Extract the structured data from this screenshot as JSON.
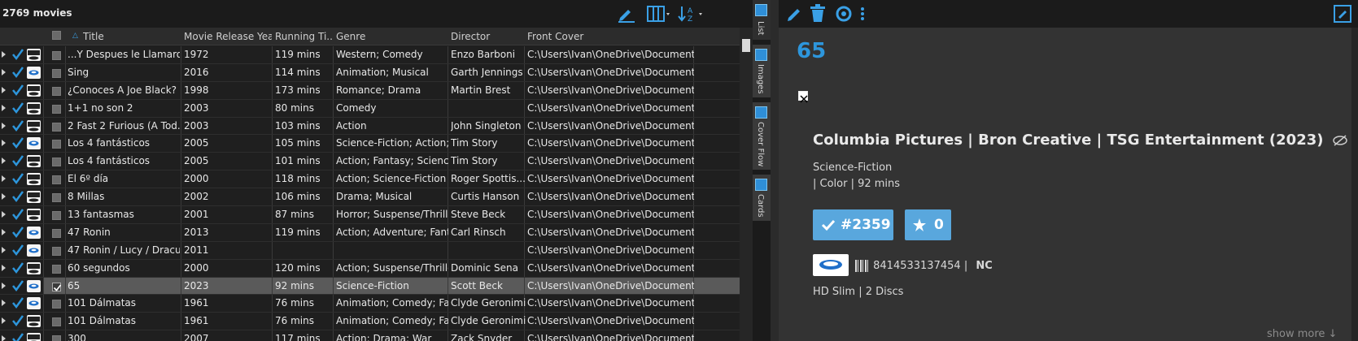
{
  "toolbar": {
    "movie_count": "2769 movies"
  },
  "columns": [
    "Title",
    "Movie Release Year",
    "Running Ti...",
    "Genre",
    "Director",
    "Front Cover"
  ],
  "rows": [
    {
      "title": "...Y Despues le Llamaro...",
      "year": "1972",
      "runtime": "119 mins",
      "genre": "Western; Comedy",
      "director": "Enzo Barboni",
      "cover": "C:\\Users\\Ivan\\OneDrive\\Document...",
      "media": "DVD",
      "checked": false,
      "selected": false
    },
    {
      "title": "Sing",
      "year": "2016",
      "runtime": "114 mins",
      "genre": "Animation; Musical",
      "director": "Garth Jennings",
      "cover": "C:\\Users\\Ivan\\OneDrive\\Document...",
      "media": "Blu-ray",
      "checked": false,
      "selected": false
    },
    {
      "title": "¿Conoces A Joe Black?",
      "year": "1998",
      "runtime": "173 mins",
      "genre": "Romance; Drama",
      "director": "Martin Brest",
      "cover": "C:\\Users\\Ivan\\OneDrive\\Document...",
      "media": "DVD",
      "checked": false,
      "selected": false
    },
    {
      "title": "1+1 no son 2",
      "year": "2003",
      "runtime": "80 mins",
      "genre": "Comedy",
      "director": "",
      "cover": "C:\\Users\\Ivan\\OneDrive\\Document...",
      "media": "DVD",
      "checked": false,
      "selected": false
    },
    {
      "title": "2 Fast 2 Furious (A Tod...",
      "year": "2003",
      "runtime": "103 mins",
      "genre": "Action",
      "director": "John Singleton",
      "cover": "C:\\Users\\Ivan\\OneDrive\\Document...",
      "media": "DVD",
      "checked": false,
      "selected": false
    },
    {
      "title": "Los 4 fantásticos",
      "year": "2005",
      "runtime": "105 mins",
      "genre": "Science-Fiction; Action; ...",
      "director": "Tim Story",
      "cover": "C:\\Users\\Ivan\\OneDrive\\Document...",
      "media": "Blu-ray",
      "checked": false,
      "selected": false
    },
    {
      "title": "Los 4 fantásticos",
      "year": "2005",
      "runtime": "101 mins",
      "genre": "Action; Fantasy; Science...",
      "director": "Tim Story",
      "cover": "C:\\Users\\Ivan\\OneDrive\\Document...",
      "media": "DVD",
      "checked": false,
      "selected": false
    },
    {
      "title": "El 6º día",
      "year": "2000",
      "runtime": "118 mins",
      "genre": "Action; Science-Fiction",
      "director": "Roger Spottis...",
      "cover": "C:\\Users\\Ivan\\OneDrive\\Document...",
      "media": "DVD",
      "checked": false,
      "selected": false
    },
    {
      "title": "8 Millas",
      "year": "2002",
      "runtime": "106 mins",
      "genre": "Drama; Musical",
      "director": "Curtis Hanson",
      "cover": "C:\\Users\\Ivan\\OneDrive\\Document...",
      "media": "DVD",
      "checked": false,
      "selected": false
    },
    {
      "title": "13 fantasmas",
      "year": "2001",
      "runtime": "87 mins",
      "genre": "Horror; Suspense/Thrill...",
      "director": "Steve Beck",
      "cover": "C:\\Users\\Ivan\\OneDrive\\Document...",
      "media": "DVD",
      "checked": false,
      "selected": false
    },
    {
      "title": "47 Ronin",
      "year": "2013",
      "runtime": "119 mins",
      "genre": "Action; Adventure; Fant...",
      "director": "Carl Rinsch",
      "cover": "C:\\Users\\Ivan\\OneDrive\\Document...",
      "media": "Blu-ray",
      "checked": false,
      "selected": false
    },
    {
      "title": "47 Ronin / Lucy / Dracu...",
      "year": "2011",
      "runtime": "",
      "genre": "",
      "director": "",
      "cover": "C:\\Users\\Ivan\\OneDrive\\Document...",
      "media": "Blu-ray",
      "checked": false,
      "selected": false
    },
    {
      "title": "60 segundos",
      "year": "2000",
      "runtime": "120 mins",
      "genre": "Action; Suspense/Thriller",
      "director": "Dominic Sena",
      "cover": "C:\\Users\\Ivan\\OneDrive\\Document...",
      "media": "DVD",
      "checked": false,
      "selected": false
    },
    {
      "title": "65",
      "year": "2023",
      "runtime": "92 mins",
      "genre": "Science-Fiction",
      "director": "Scott Beck",
      "cover": "C:\\Users\\Ivan\\OneDrive\\Document...",
      "media": "Blu-ray",
      "checked": true,
      "selected": true
    },
    {
      "title": "101 Dálmatas",
      "year": "1961",
      "runtime": "76 mins",
      "genre": "Animation; Comedy; Fa...",
      "director": "Clyde Geronimi",
      "cover": "C:\\Users\\Ivan\\OneDrive\\Document...",
      "media": "Blu-ray",
      "checked": false,
      "selected": false
    },
    {
      "title": "101 Dálmatas",
      "year": "1961",
      "runtime": "76 mins",
      "genre": "Animation; Comedy; Fa...",
      "director": "Clyde Geronimi",
      "cover": "C:\\Users\\Ivan\\OneDrive\\Document...",
      "media": "DVD",
      "checked": false,
      "selected": false
    },
    {
      "title": "300",
      "year": "2007",
      "runtime": "117 mins",
      "genre": "Action; Drama; War",
      "director": "Zack Snyder",
      "cover": "C:\\Users\\Ivan\\OneDrive\\Document...",
      "media": "DVD",
      "checked": false,
      "selected": false
    }
  ],
  "view_tabs": [
    "List",
    "Images",
    "Cover Flow",
    "Cards"
  ],
  "detail": {
    "title": "65",
    "studio": "Columbia Pictures | Bron Creative | TSG Entertainment (2023)",
    "genre": "Science-Fiction",
    "specs": "| Color | 92 mins",
    "index_badge": "#2359",
    "rating_badge": "0",
    "barcode": "8414533137454",
    "rating_code": "NC",
    "edition": "HD Slim | 2 Discs",
    "show_more": "show more ↓"
  },
  "colors": {
    "accent": "#2d96dc",
    "badge": "#59a7dd",
    "selected_row": "#5a5a5a"
  }
}
